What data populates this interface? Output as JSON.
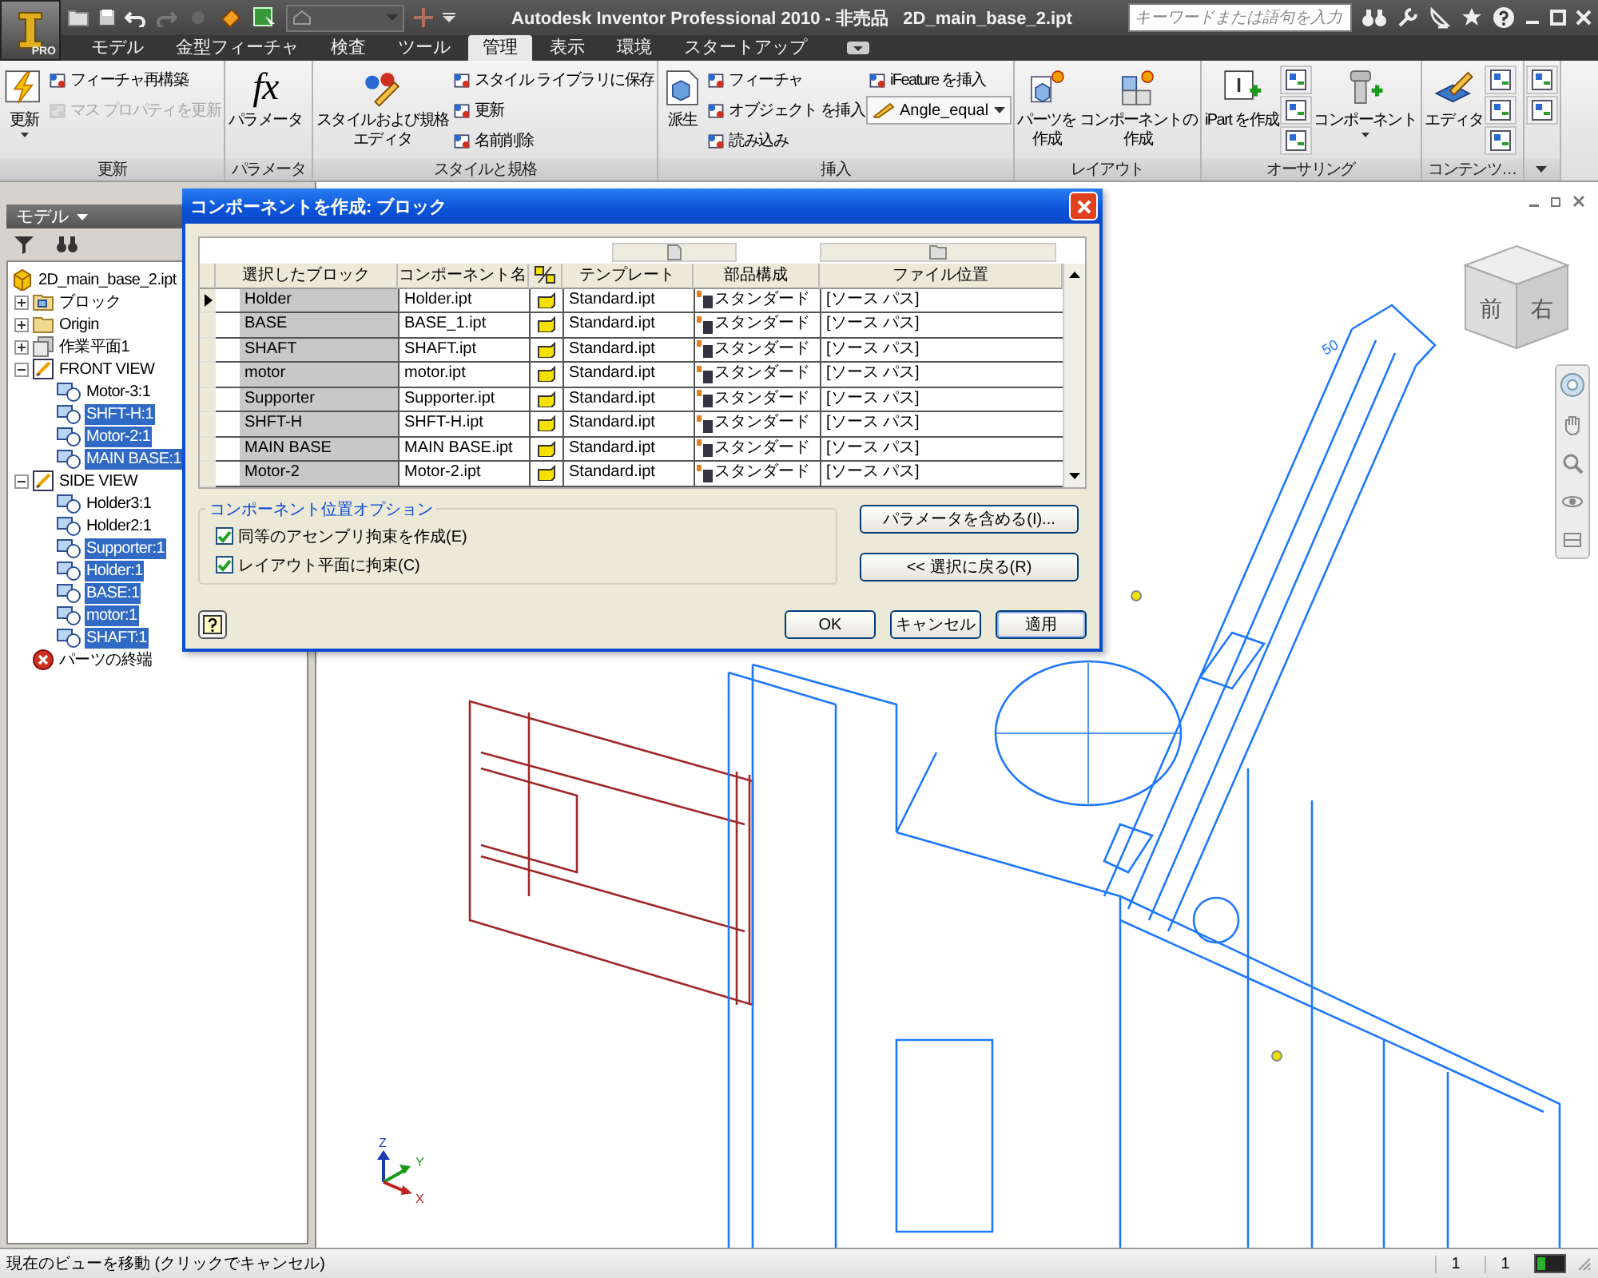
{
  "window": {
    "title": "Autodesk Inventor Professional 2010 - 非売品   2D_main_base_2.ipt",
    "app_badge": "PRO",
    "search": {
      "placeholder": "キーワードまたは語句を入力"
    }
  },
  "ribbon_tabs": [
    {
      "label": "モデル",
      "selected": false
    },
    {
      "label": "金型フィーチャ",
      "selected": false
    },
    {
      "label": "検査",
      "selected": false
    },
    {
      "label": "ツール",
      "selected": false
    },
    {
      "label": "管理",
      "selected": true
    },
    {
      "label": "表示",
      "selected": false
    },
    {
      "label": "環境",
      "selected": false
    },
    {
      "label": "スタートアップ",
      "selected": false
    }
  ],
  "ribbon_panels": [
    {
      "title": "更新",
      "columns": [
        [
          {
            "kind": "large",
            "label": "更新",
            "dropdown": true
          }
        ],
        [
          {
            "kind": "small",
            "label": "フィーチャ再構築",
            "disabled": false
          },
          {
            "kind": "small",
            "label": "マス プロパティを更新",
            "disabled": true
          }
        ]
      ]
    },
    {
      "title": "パラメータ",
      "columns": [
        [
          {
            "kind": "large",
            "label": "パラメータ",
            "glyph": "fx",
            "dropdown": false
          }
        ]
      ]
    },
    {
      "title": "スタイルと規格",
      "columns": [
        [
          {
            "kind": "large",
            "label": [
              "スタイルおよび規格",
              "エディタ"
            ],
            "dropdown": false
          }
        ],
        [
          {
            "kind": "small",
            "label": "スタイル ライブラリに保存",
            "disabled": false
          },
          {
            "kind": "small",
            "label": "更新",
            "disabled": false
          },
          {
            "kind": "small",
            "label": "名前削除",
            "disabled": false
          }
        ]
      ]
    },
    {
      "title": "挿入",
      "columns": [
        [
          {
            "kind": "large",
            "label": "派生",
            "dropdown": false
          }
        ],
        [
          {
            "kind": "small",
            "label": "フィーチャ",
            "disabled": false
          },
          {
            "kind": "small",
            "label": "オブジェクト を挿入",
            "disabled": false
          },
          {
            "kind": "small",
            "label": "読み込み",
            "disabled": false
          }
        ],
        [
          {
            "kind": "small",
            "label": "iFeature を挿入",
            "disabled": false
          },
          {
            "kind": "combo",
            "value": "Angle_equal"
          }
        ]
      ]
    },
    {
      "title": "レイアウト",
      "columns": [
        [
          {
            "kind": "large",
            "label": [
              "パーツを",
              "作成"
            ],
            "dropdown": false
          }
        ],
        [
          {
            "kind": "large",
            "label": [
              "コンポーネントの",
              "作成"
            ],
            "dropdown": false
          }
        ]
      ]
    },
    {
      "title": "オーサリング",
      "columns": [
        [
          {
            "kind": "large",
            "label": "iPart を作成",
            "dropdown": false
          }
        ],
        [
          {
            "kind": "icon"
          },
          {
            "kind": "icon"
          },
          {
            "kind": "icon"
          }
        ],
        [
          {
            "kind": "large",
            "label": "コンポーネント",
            "dropdown": true
          }
        ]
      ]
    },
    {
      "title": "コンテンツ…",
      "columns": [
        [
          {
            "kind": "large",
            "label": "エディタ",
            "dropdown": false
          }
        ],
        [
          {
            "kind": "icon"
          },
          {
            "kind": "icon"
          },
          {
            "kind": "icon"
          }
        ]
      ]
    },
    {
      "columns": [
        [
          {
            "kind": "icon"
          },
          {
            "kind": "icon"
          }
        ]
      ]
    }
  ],
  "browser": {
    "title": "モデル",
    "tree": [
      {
        "label": "2D_main_base_2.ipt",
        "kind": "part",
        "selected": false,
        "children": [
          {
            "label": "ブロック",
            "kind": "block-folder",
            "expanded": false,
            "selected": false
          },
          {
            "label": "Origin",
            "kind": "folder",
            "expanded": false,
            "selected": false
          },
          {
            "label": "作業平面1",
            "kind": "workplane",
            "expanded": false,
            "selected": false
          },
          {
            "label": "FRONT VIEW",
            "kind": "sketch",
            "expanded": true,
            "selected": false,
            "children": [
              {
                "label": "Motor-3:1",
                "kind": "instance",
                "selected": false
              },
              {
                "label": "SHFT-H:1",
                "kind": "instance",
                "selected": true
              },
              {
                "label": "Motor-2:1",
                "kind": "instance",
                "selected": true
              },
              {
                "label": "MAIN BASE:1",
                "kind": "instance",
                "selected": true
              }
            ]
          },
          {
            "label": "SIDE VIEW",
            "kind": "sketch",
            "expanded": true,
            "selected": false,
            "children": [
              {
                "label": "Holder3:1",
                "kind": "instance",
                "selected": false
              },
              {
                "label": "Holder2:1",
                "kind": "instance",
                "selected": false
              },
              {
                "label": "Supporter:1",
                "kind": "instance",
                "selected": true
              },
              {
                "label": "Holder:1",
                "kind": "instance",
                "selected": true
              },
              {
                "label": "BASE:1",
                "kind": "instance",
                "selected": true
              },
              {
                "label": "motor:1",
                "kind": "instance",
                "selected": true
              },
              {
                "label": "SHAFT:1",
                "kind": "instance",
                "selected": true
              }
            ]
          },
          {
            "label": "パーツの終端",
            "kind": "end",
            "selected": false
          }
        ]
      }
    ]
  },
  "viewport": {
    "viewcube": [
      "前",
      "右"
    ],
    "dimension": "50",
    "axes": [
      "Z",
      "Y",
      "X"
    ]
  },
  "dialog": {
    "title": "コンポーネントを作成: ブロック",
    "columns": [
      "選択したブロック",
      "コンポーネント名",
      "テンプレート",
      "部品構成",
      "ファイル位置"
    ],
    "rows": [
      {
        "block": "Holder",
        "name": "Holder.ipt",
        "template": "Standard.ipt",
        "bom": "スタンダード",
        "location": "[ソース パス]",
        "selected": true
      },
      {
        "block": "BASE",
        "name": "BASE_1.ipt",
        "template": "Standard.ipt",
        "bom": "スタンダード",
        "location": "[ソース パス]",
        "selected": false
      },
      {
        "block": "SHAFT",
        "name": "SHAFT.ipt",
        "template": "Standard.ipt",
        "bom": "スタンダード",
        "location": "[ソース パス]",
        "selected": false
      },
      {
        "block": "motor",
        "name": "motor.ipt",
        "template": "Standard.ipt",
        "bom": "スタンダード",
        "location": "[ソース パス]",
        "selected": false
      },
      {
        "block": "Supporter",
        "name": "Supporter.ipt",
        "template": "Standard.ipt",
        "bom": "スタンダード",
        "location": "[ソース パス]",
        "selected": false
      },
      {
        "block": "SHFT-H",
        "name": "SHFT-H.ipt",
        "template": "Standard.ipt",
        "bom": "スタンダード",
        "location": "[ソース パス]",
        "selected": false
      },
      {
        "block": "MAIN BASE",
        "name": "MAIN BASE.ipt",
        "template": "Standard.ipt",
        "bom": "スタンダード",
        "location": "[ソース パス]",
        "selected": false
      },
      {
        "block": "Motor-2",
        "name": "Motor-2.ipt",
        "template": "Standard.ipt",
        "bom": "スタンダード",
        "location": "[ソース パス]",
        "selected": false
      }
    ],
    "options": {
      "title": "コンポーネント位置オプション",
      "checkboxes": [
        {
          "label": "同等のアセンブリ拘束を作成(E)",
          "checked": true
        },
        {
          "label": "レイアウト平面に拘束(C)",
          "checked": true
        }
      ]
    },
    "side_buttons": [
      "パラメータを含める(I)...",
      "<< 選択に戻る(R)"
    ],
    "buttons": [
      {
        "label": "OK",
        "default": false
      },
      {
        "label": "キャンセル",
        "default": false
      },
      {
        "label": "適用",
        "default": true
      }
    ]
  },
  "status_bar": {
    "message": "現在のビューを移動 (クリックでキャンセル)",
    "cells": [
      "1",
      "1"
    ]
  }
}
